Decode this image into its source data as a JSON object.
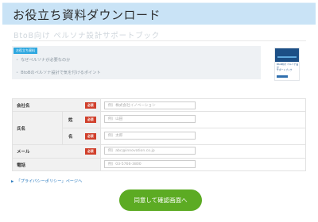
{
  "header": {
    "title": "お役立ち資料ダウンロード"
  },
  "document": {
    "subtitle": "BtoB向け ペルソナ設計サポートブック"
  },
  "intro": {
    "badge": "お役立ち資料",
    "items": [
      "なぜペルソナが必要なのか",
      "BtoBのペルソナ設計で気を付けるポイント"
    ]
  },
  "book": {
    "text": "BtoB向け ペルソナ設計\nサポートブック"
  },
  "form": {
    "required_label": "必須",
    "fields": {
      "company": {
        "label": "会社名",
        "placeholder": "例）株式会社イノベーション"
      },
      "name": {
        "label": "氏名"
      },
      "last_name": {
        "label": "姓",
        "placeholder": "例）山田"
      },
      "first_name": {
        "label": "名",
        "placeholder": "例）太郎"
      },
      "email": {
        "label": "メール",
        "placeholder": "例）abc@innovation.co.jp"
      },
      "phone": {
        "label": "電話",
        "placeholder": "例）03-5766-3800"
      }
    }
  },
  "privacy": {
    "label": "「プライバシーポリシー」ページへ"
  },
  "submit": {
    "label": "同意して確認画面へ"
  },
  "colors": {
    "banner": "#c9e3f6",
    "badge": "#2fa8e0",
    "required": "#d0402c",
    "submit": "#5cab23",
    "link": "#2c7cc0"
  }
}
